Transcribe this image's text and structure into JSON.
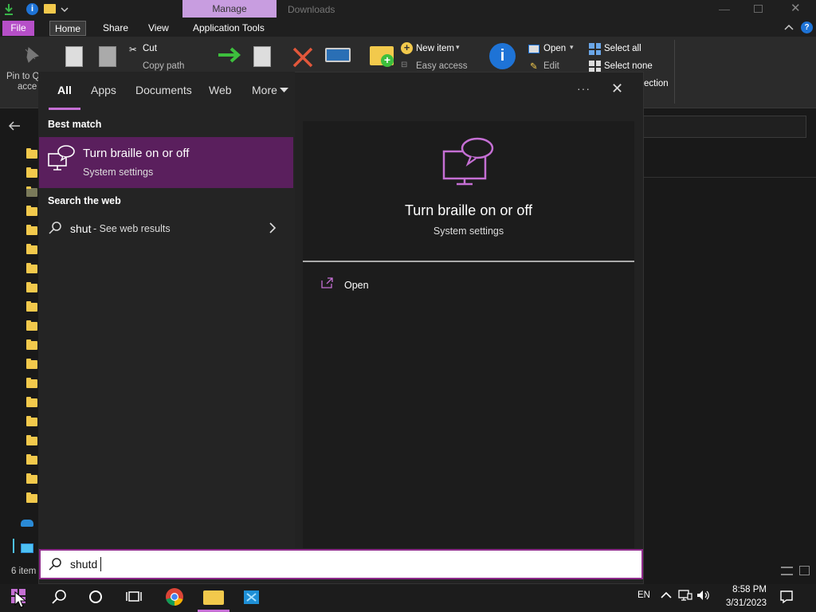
{
  "titlebar": {
    "context_tab": "Manage",
    "window_title": "Downloads",
    "quick_access_info": "i"
  },
  "ribbon_tabs": [
    "File",
    "Home",
    "Share",
    "View",
    "Application Tools"
  ],
  "ribbon": {
    "pin_label_1": "Pin to Q",
    "pin_label_2": "acce",
    "cut": "Cut",
    "copy_path": "Copy path",
    "new_item": "New item",
    "easy_access": "Easy access",
    "open": "Open",
    "edit": "Edit",
    "select_all": "Select all",
    "select_none": "Select none",
    "invert_selection_partial": "ection"
  },
  "status": {
    "items_count": "6 item"
  },
  "start": {
    "tabs": [
      "All",
      "Apps",
      "Documents",
      "Web",
      "More"
    ],
    "active_tab": "All",
    "more_options": "···",
    "close": "✕",
    "best_match_header": "Best match",
    "best_match": {
      "title": "Turn braille on or off",
      "subtitle": "System settings"
    },
    "web_header": "Search the web",
    "web_result": {
      "query": "shut",
      "suffix": " - See web results"
    },
    "preview": {
      "title": "Turn braille on or off",
      "subtitle": "System settings"
    },
    "actions": [
      {
        "label": "Open"
      }
    ],
    "search_value": "shutd"
  },
  "tray": {
    "language": "EN",
    "time": "8:58 PM",
    "date": "3/31/2023"
  },
  "colors": {
    "accent": "#c56fd4",
    "highlight": "#5a1f5d",
    "search_border": "#8e2b8b"
  }
}
